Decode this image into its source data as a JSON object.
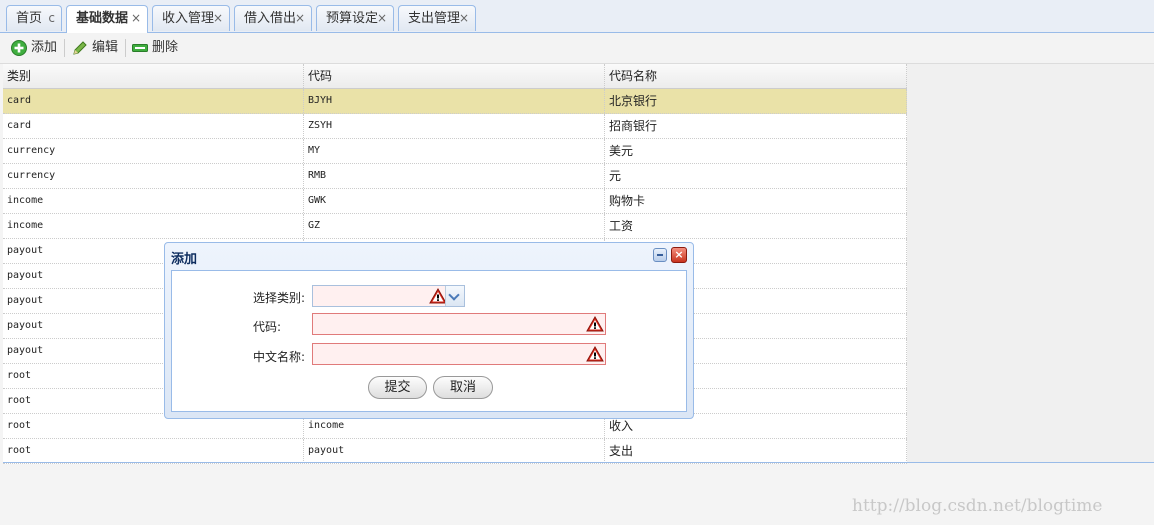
{
  "tabs": [
    {
      "label": "首页",
      "close": "c",
      "active": false
    },
    {
      "label": "基础数据",
      "close": "×",
      "active": true
    },
    {
      "label": "收入管理",
      "close": "×",
      "active": false
    },
    {
      "label": "借入借出",
      "close": "×",
      "active": false
    },
    {
      "label": "预算设定",
      "close": "×",
      "active": false
    },
    {
      "label": "支出管理",
      "close": "×",
      "active": false
    }
  ],
  "toolbar": {
    "add": {
      "label": "添加",
      "icon": "add-icon"
    },
    "edit": {
      "label": "编辑",
      "icon": "pencil-icon"
    },
    "delete": {
      "label": "删除",
      "icon": "minus-icon"
    }
  },
  "grid": {
    "columns": [
      "类别",
      "代码",
      "代码名称"
    ],
    "rows": [
      {
        "type": "card",
        "code": "BJYH",
        "name": "北京银行",
        "selected": true
      },
      {
        "type": "card",
        "code": "ZSYH",
        "name": "招商银行"
      },
      {
        "type": "currency",
        "code": "MY",
        "name": "美元"
      },
      {
        "type": "currency",
        "code": "RMB",
        "name": "元"
      },
      {
        "type": "income",
        "code": "GWK",
        "name": "购物卡"
      },
      {
        "type": "income",
        "code": "GZ",
        "name": "工资"
      },
      {
        "type": "payout",
        "code": "",
        "name": ""
      },
      {
        "type": "payout",
        "code": "",
        "name": ""
      },
      {
        "type": "payout",
        "code": "",
        "name": ""
      },
      {
        "type": "payout",
        "code": "",
        "name": ""
      },
      {
        "type": "payout",
        "code": "",
        "name": ""
      },
      {
        "type": "root",
        "code": "",
        "name": ""
      },
      {
        "type": "root",
        "code": "",
        "name": ""
      },
      {
        "type": "root",
        "code": "income",
        "name": "收入"
      },
      {
        "type": "root",
        "code": "payout",
        "name": "支出"
      }
    ]
  },
  "dialog": {
    "title": "添加",
    "fields": [
      {
        "label": "选择类别:",
        "value": ""
      },
      {
        "label": "代码:",
        "value": ""
      },
      {
        "label": "中文名称:",
        "value": ""
      }
    ],
    "submit": "提交",
    "cancel": "取消"
  },
  "watermark": "http://blog.csdn.net/blogtime",
  "colors": {
    "selected_row": "#eae2a8",
    "border_blue": "#99bbe8",
    "invalid_border": "#e07a7a"
  }
}
